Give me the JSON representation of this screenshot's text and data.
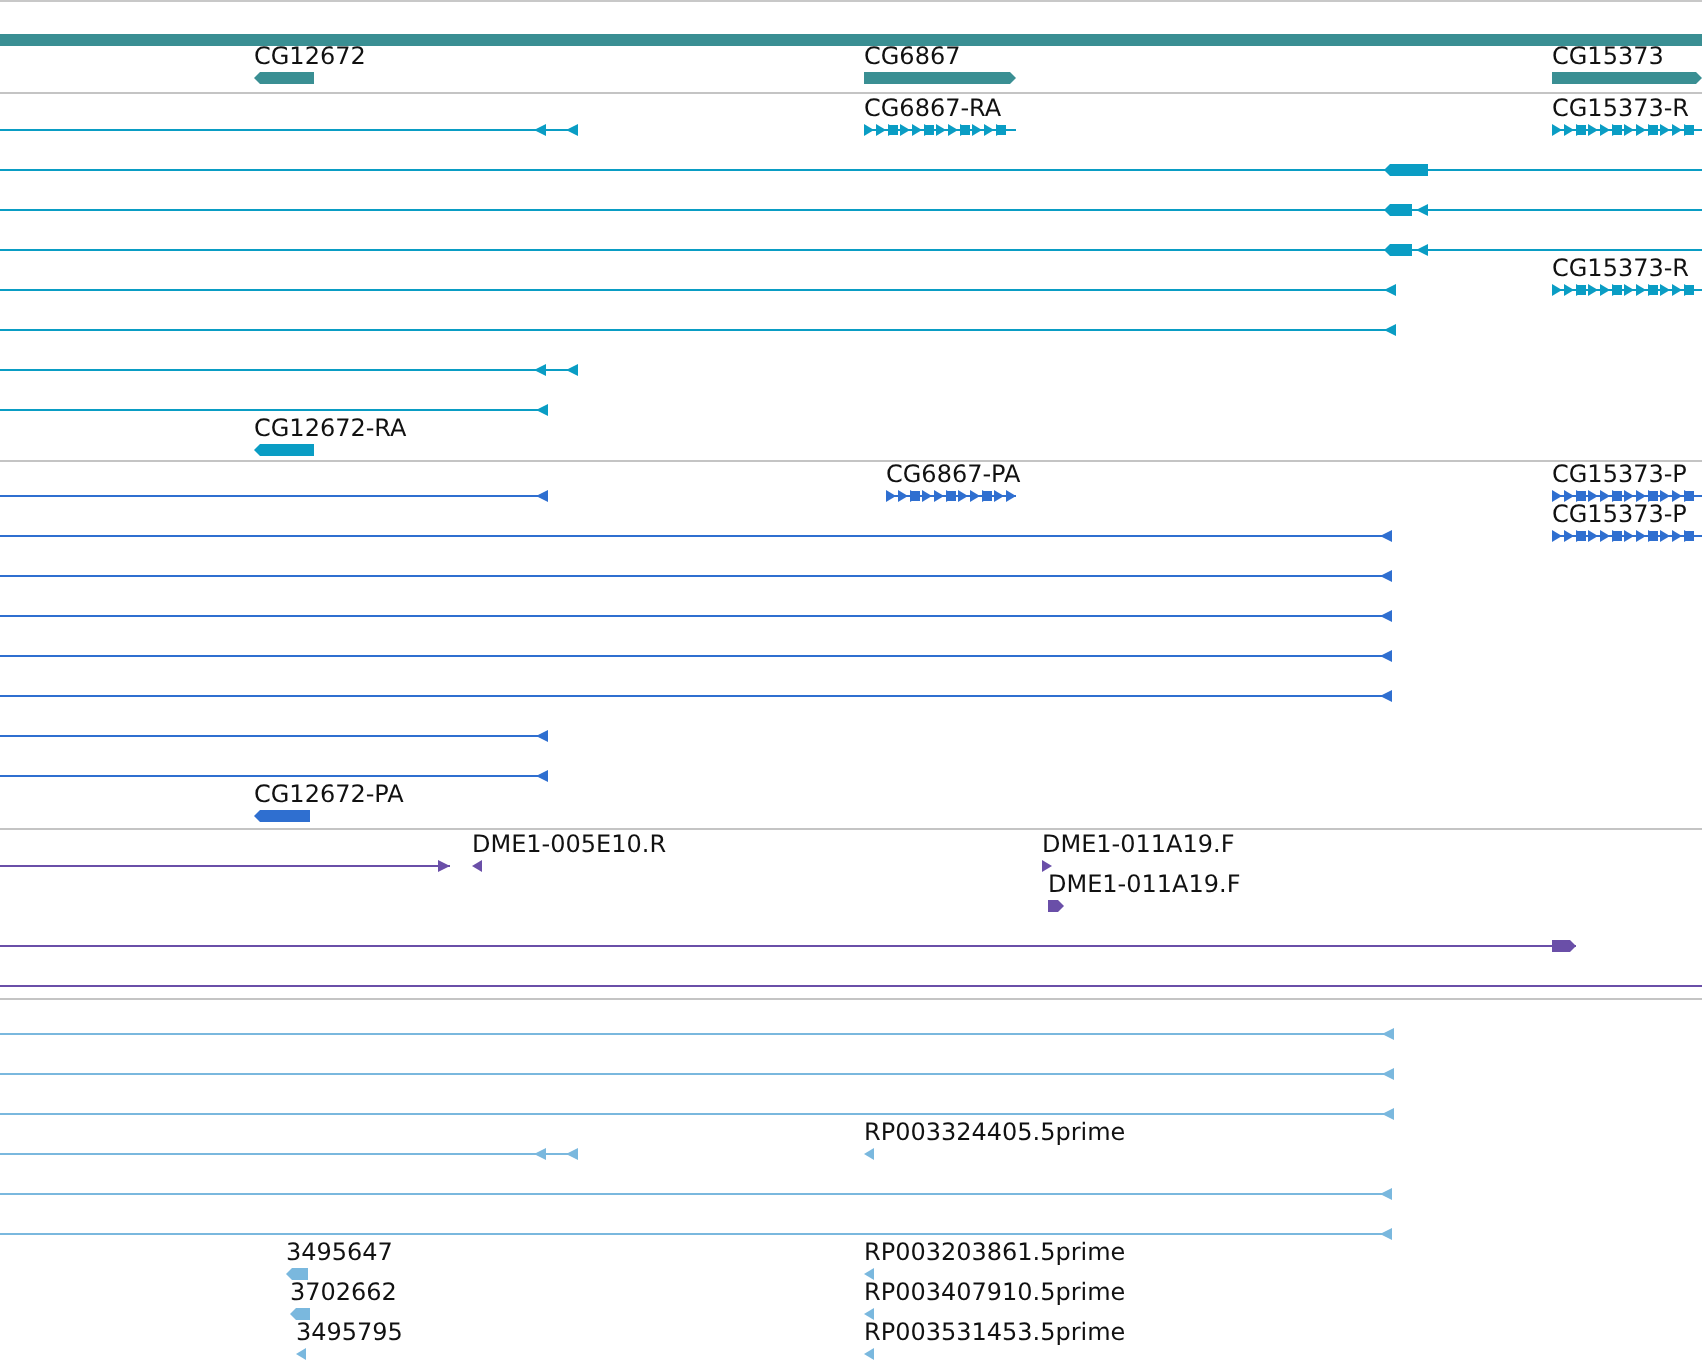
{
  "tracks": [
    {
      "kind": "gene",
      "features": [
        {
          "label": "CG12672"
        },
        {
          "label": "CG6867"
        },
        {
          "label": "CG15373"
        }
      ]
    },
    {
      "kind": "transcript",
      "features": [
        {
          "label": "CG6867-RA"
        },
        {
          "label": "CG15373-R"
        },
        {
          "label": "CG15373-R"
        },
        {
          "label": "CG12672-RA"
        }
      ]
    },
    {
      "kind": "protein",
      "features": [
        {
          "label": "CG6867-PA"
        },
        {
          "label": "CG15373-P"
        },
        {
          "label": "CG15373-P"
        },
        {
          "label": "CG12672-PA"
        }
      ]
    },
    {
      "kind": "clone",
      "features": [
        {
          "label": "DME1-005E10.R"
        },
        {
          "label": "DME1-011A19.F"
        },
        {
          "label": "DME1-011A19.F"
        }
      ]
    },
    {
      "kind": "est",
      "features": [
        {
          "label": "RP003324405.5prime"
        },
        {
          "label": "3495647"
        },
        {
          "label": "RP003203861.5prime"
        },
        {
          "label": "3702662"
        },
        {
          "label": "RP003407910.5prime"
        },
        {
          "label": "3495795"
        },
        {
          "label": "RP003531453.5prime"
        }
      ]
    }
  ]
}
